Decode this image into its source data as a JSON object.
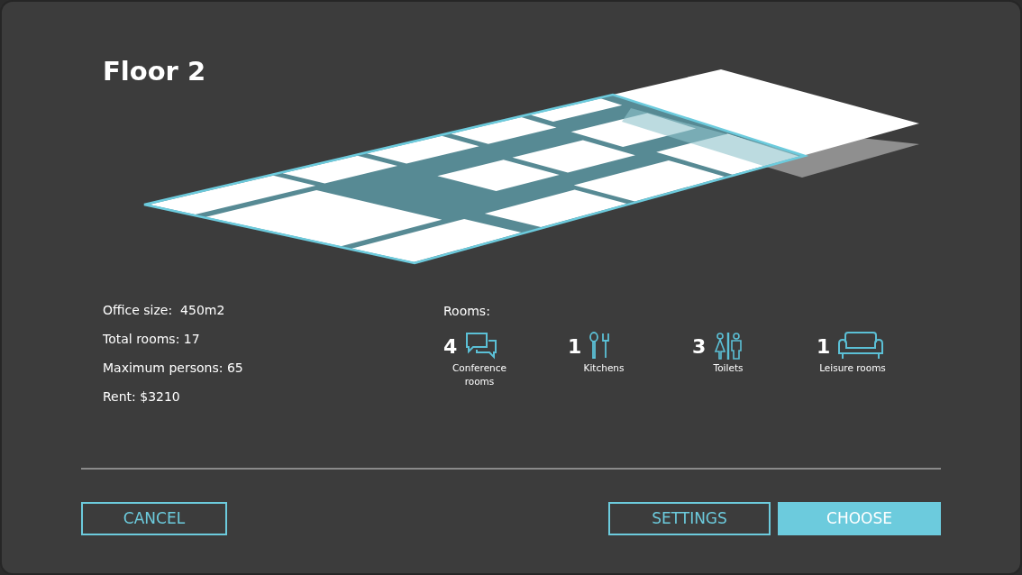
{
  "title": "Floor 2",
  "stats": [
    "Office size:  450m2",
    "Total rooms: 17",
    "Maximum persons: 65",
    "Rent: $3210"
  ],
  "rooms_label": "Rooms:",
  "rooms": [
    {
      "count": "4",
      "label": "Conference rooms",
      "kind": "conference"
    },
    {
      "count": "1",
      "label": "Kitchens",
      "kind": "kitchen"
    },
    {
      "count": "3",
      "label": "Toilets",
      "kind": "toilet"
    },
    {
      "count": "1",
      "label": "Leisure rooms",
      "kind": "leisure"
    }
  ],
  "buttons": [
    {
      "label": "CANCEL",
      "kind": "outline"
    },
    {
      "label": "SETTINGS",
      "kind": "outline"
    },
    {
      "label": "CHOOSE",
      "kind": "primary"
    }
  ]
}
